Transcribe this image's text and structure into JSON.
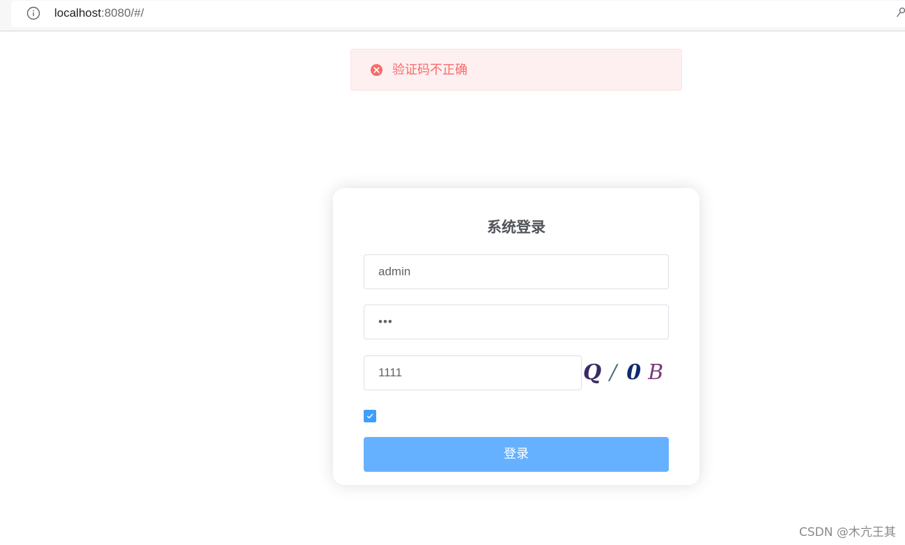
{
  "browser": {
    "url_host": "localhost",
    "url_rest": ":8080/#/"
  },
  "message": {
    "text": "验证码不正确",
    "type": "error",
    "color": "#f56c6c"
  },
  "login": {
    "title": "系统登录",
    "username": "admin",
    "password": "•••",
    "code": "1111",
    "captcha_text": "Q/0B",
    "remember_checked": true,
    "submit_label": "登录",
    "accent": "#409eff",
    "button_color": "#66b1ff"
  },
  "watermark": "CSDN @木亢王其"
}
